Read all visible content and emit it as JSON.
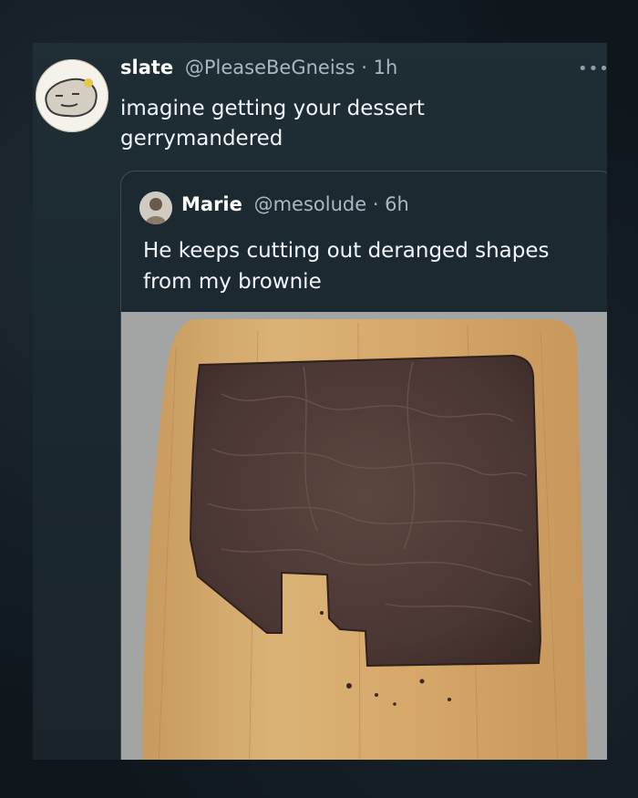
{
  "tweet": {
    "display_name": "slate",
    "handle": "@PleaseBeGneiss",
    "time": "· 1h",
    "text": "imagine getting your dessert gerrymandered",
    "more_icon": "more-horizontal-icon"
  },
  "quoted_tweet": {
    "display_name": "Marie",
    "handle": "@mesolude",
    "time": "· 6h",
    "text": "He keeps cutting out deranged shapes from my brownie",
    "image_subject": "brownie-on-cutting-board"
  },
  "colors": {
    "background": "#0f171d",
    "card": "#1f2d35",
    "primary_text": "#f2f5f7",
    "secondary_text": "#aab8c2",
    "border": "#3b4c57"
  }
}
